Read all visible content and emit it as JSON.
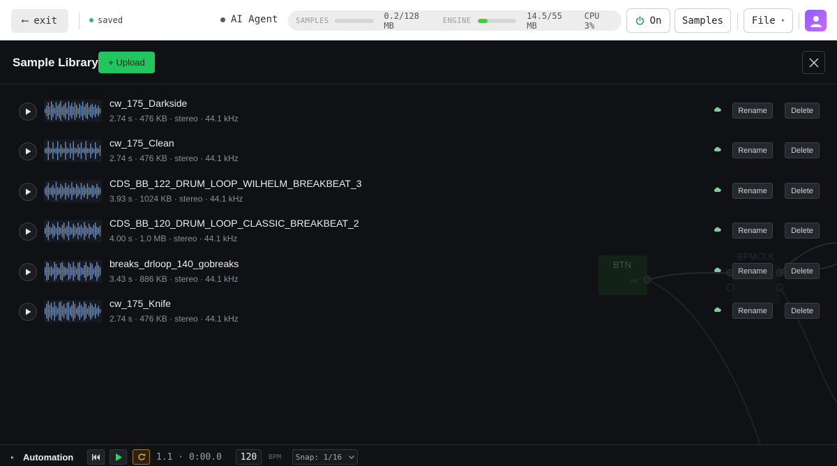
{
  "topbar": {
    "exit_label": "exit",
    "exit_arrow": "⟵",
    "saved_label": "saved",
    "agent_label": "AI Agent",
    "samples_meter_label": "SAMPLES",
    "samples_value": "0.2/128 MB",
    "samples_fraction": 0.0016,
    "engine_meter_label": "ENGINE",
    "engine_value": "14.5/55 MB",
    "engine_fraction": 0.26,
    "cpu_label": "CPU 3%",
    "power_label": "On",
    "samples_button": "Samples",
    "file_button": "File",
    "file_caret": "▾",
    "colors": {
      "saved_dot": "#22c55e",
      "engine_fill": "#3bd13b",
      "power_icon": "#1f9d4a"
    }
  },
  "panel": {
    "title": "Sample Library",
    "upload_label": "+ Upload",
    "rename_label": "Rename",
    "delete_label": "Delete",
    "samples": [
      {
        "name": "cw_175_Darkside",
        "meta": "2.74 s · 476 KB · stereo · 44.1 kHz"
      },
      {
        "name": "cw_175_Clean",
        "meta": "2.74 s · 476 KB · stereo · 44.1 kHz"
      },
      {
        "name": "CDS_BB_122_DRUM_LOOP_WILHELM_BREAKBEAT_3",
        "meta": "3.93 s · 1024 KB · stereo · 44.1 kHz"
      },
      {
        "name": "CDS_BB_120_DRUM_LOOP_CLASSIC_BREAKBEAT_2",
        "meta": "4.00 s · 1.0 MB · stereo · 44.1 kHz"
      },
      {
        "name": "breaks_drloop_140_gobreaks",
        "meta": "3.43 s · 886 KB · stereo · 44.1 kHz"
      },
      {
        "name": "cw_175_Knife",
        "meta": "2.74 s · 476 KB · stereo · 44.1 kHz"
      }
    ],
    "graph": {
      "node_btn": "BTN",
      "node_bpmclk": "BPMCLK"
    }
  },
  "bottombar": {
    "automation_label": "Automation",
    "position": "1.1 · 0:00.0",
    "bpm_value": "120",
    "bpm_label": "BPM",
    "snap_label": "Snap: 1/16"
  }
}
